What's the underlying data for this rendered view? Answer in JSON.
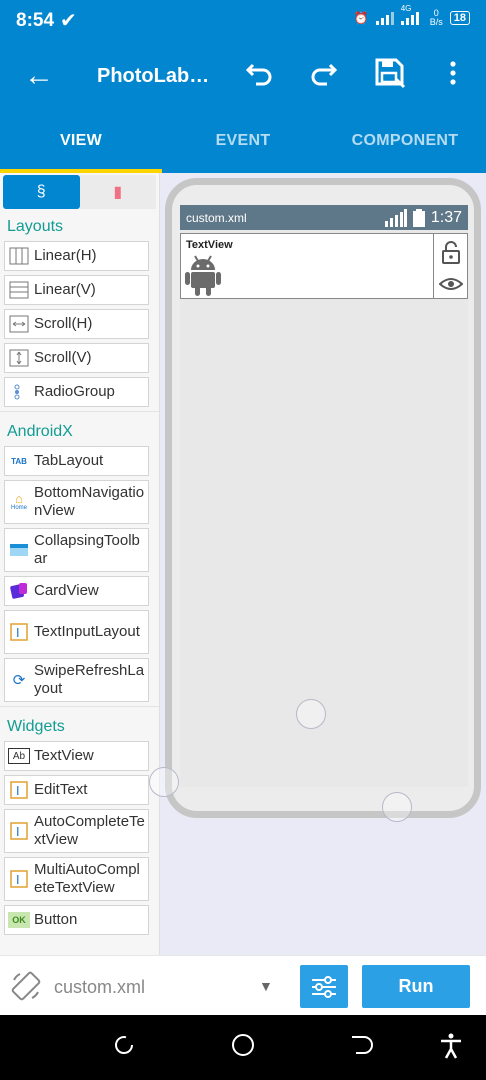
{
  "status": {
    "time": "8:54",
    "network": "4G",
    "speed_value": "0",
    "speed_unit": "B/s",
    "battery": "18"
  },
  "appbar": {
    "title": "PhotoLabD..."
  },
  "tabs": [
    {
      "label": "VIEW"
    },
    {
      "label": "EVENT"
    },
    {
      "label": "COMPONENT"
    }
  ],
  "palette": {
    "sections": {
      "layouts": "Layouts",
      "androidx": "AndroidX",
      "widgets": "Widgets"
    },
    "layouts": [
      {
        "label": "Linear(H)"
      },
      {
        "label": "Linear(V)"
      },
      {
        "label": "Scroll(H)"
      },
      {
        "label": "Scroll(V)"
      },
      {
        "label": "RadioGroup"
      }
    ],
    "androidx": [
      {
        "label": "TabLayout",
        "icon_text": "TAB"
      },
      {
        "label": "BottomNavigationView",
        "icon_text": "Home"
      },
      {
        "label": "CollapsingToolbar"
      },
      {
        "label": "CardView"
      },
      {
        "label": "TextInputLayout"
      },
      {
        "label": "SwipeRefreshLayout"
      }
    ],
    "widgets": [
      {
        "label": "TextView",
        "icon_text": "Ab"
      },
      {
        "label": "EditText"
      },
      {
        "label": "AutoCompleteTextView"
      },
      {
        "label": "MultiAutoCompleteTextView"
      },
      {
        "label": "Button",
        "icon_text": "OK"
      }
    ]
  },
  "preview": {
    "filename": "custom.xml",
    "clock": "1:37",
    "widget_label": "TextView"
  },
  "bottom": {
    "file": "custom.xml",
    "run_label": "Run"
  },
  "colors": {
    "primary": "#0286d0",
    "accent": "#fcd400",
    "section": "#139c93",
    "button": "#2ba0e4"
  }
}
